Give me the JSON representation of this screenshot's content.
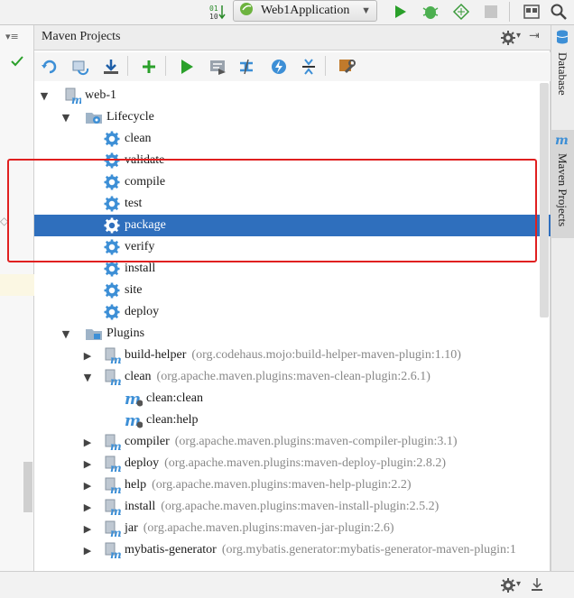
{
  "top_toolbar": {
    "run_config_label": "Web1Application"
  },
  "panel": {
    "title": "Maven Projects"
  },
  "tree": {
    "project": "web-1",
    "lifecycle": {
      "label": "Lifecycle",
      "phases": [
        "clean",
        "validate",
        "compile",
        "test",
        "package",
        "verify",
        "install",
        "site",
        "deploy"
      ],
      "selected": "package"
    },
    "plugins": {
      "label": "Plugins",
      "items": [
        {
          "name": "build-helper",
          "coord": "(org.codehaus.mojo:build-helper-maven-plugin:1.10)"
        },
        {
          "name": "clean",
          "coord": "(org.apache.maven.plugins:maven-clean-plugin:2.6.1)"
        },
        {
          "name": "compiler",
          "coord": "(org.apache.maven.plugins:maven-compiler-plugin:3.1)"
        },
        {
          "name": "deploy",
          "coord": "(org.apache.maven.plugins:maven-deploy-plugin:2.8.2)"
        },
        {
          "name": "help",
          "coord": "(org.apache.maven.plugins:maven-help-plugin:2.2)"
        },
        {
          "name": "install",
          "coord": "(org.apache.maven.plugins:maven-install-plugin:2.5.2)"
        },
        {
          "name": "jar",
          "coord": "(org.apache.maven.plugins:maven-jar-plugin:2.6)"
        },
        {
          "name": "mybatis-generator",
          "coord": "(org.mybatis.generator:mybatis-generator-maven-plugin:1"
        }
      ],
      "clean_goals": [
        "clean:clean",
        "clean:help"
      ]
    }
  },
  "right_tabs": {
    "database": "Database",
    "maven": "Maven Projects"
  },
  "colors": {
    "selection": "#2f6fbd",
    "highlight_box": "#e02020",
    "gear": "#3d8fd6",
    "run_green": "#2aa02a"
  }
}
